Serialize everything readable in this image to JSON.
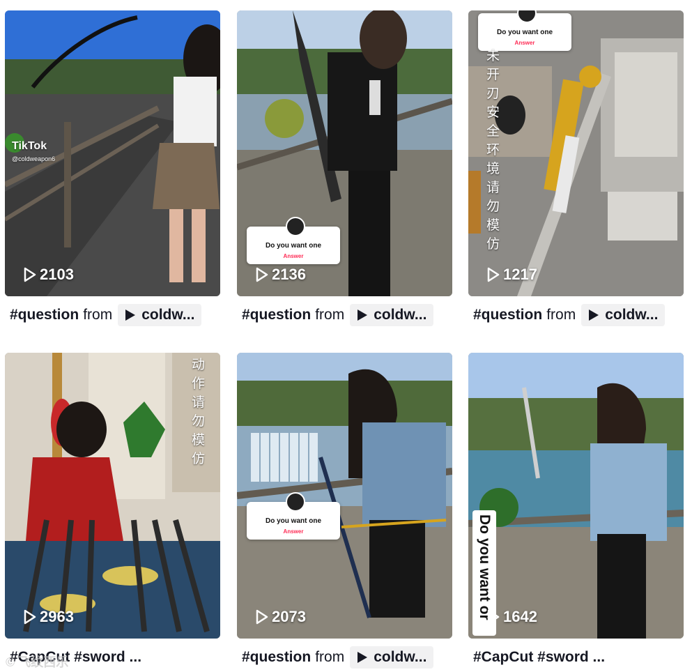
{
  "videos": [
    {
      "views": "2103",
      "caption_tag": "#question",
      "caption_from": "from",
      "chip_label": "coldw...",
      "overlay": {
        "tiktok_logo": "TikTok",
        "handle": "@coldweapon6"
      }
    },
    {
      "views": "2136",
      "caption_tag": "#question",
      "caption_from": "from",
      "chip_label": "coldw...",
      "overlay": {
        "question": "Do you want one",
        "answer_label": "Answer"
      }
    },
    {
      "views": "1217",
      "caption_tag": "#question",
      "caption_from": "from",
      "chip_label": "coldw...",
      "overlay": {
        "question": "Do you want one",
        "answer_label": "Answer",
        "vertical_text": "未开刃安全环境请勿模仿"
      }
    },
    {
      "views": "2963",
      "caption_tag": "#CapCut #sword ...",
      "overlay": {
        "vertical_text": "动作请勿模仿"
      }
    },
    {
      "views": "2073",
      "caption_tag": "#question",
      "caption_from": "from",
      "chip_label": "coldw...",
      "overlay": {
        "question": "Do you want one",
        "answer_label": "Answer"
      }
    },
    {
      "views": "1642",
      "caption_tag": "#CapCut #sword ...",
      "overlay": {
        "vertical_banner": "Do you want or"
      }
    }
  ],
  "colors": {
    "answer_accent": "#fe2c55",
    "chip_bg": "#f1f1f2",
    "text": "#161823"
  },
  "watermark": "© 飞纹西乐"
}
